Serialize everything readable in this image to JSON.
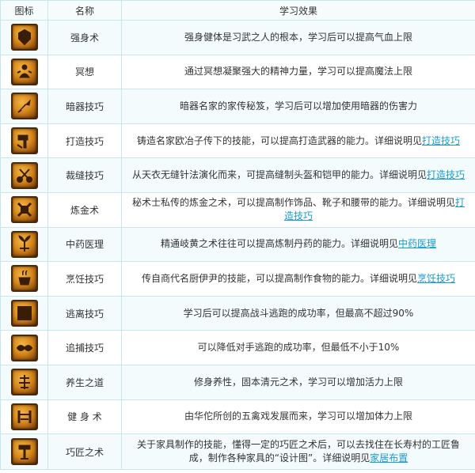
{
  "headers": {
    "icon": "图标",
    "name": "名称",
    "effect": "学习效果"
  },
  "rows": [
    {
      "icon": "strength-icon",
      "name": "强身术",
      "effect": "强身健体是习武之人的根本，学习后可以提高气血上限",
      "link": ""
    },
    {
      "icon": "meditation-icon",
      "name": "冥想",
      "effect": "通过冥想凝聚强大的精神力量，学习可以提高魔法上限",
      "link": ""
    },
    {
      "icon": "dart-icon",
      "name": "暗器技巧",
      "effect": "暗器名家的家传秘笈，学习后可以增加使用暗器的伤害力",
      "link": ""
    },
    {
      "icon": "hammer-icon",
      "name": "打造技巧",
      "effect": "铸造名家欧冶子传下的技能，可以提高打造武器的能力。详细说明见",
      "link": "打造技巧"
    },
    {
      "icon": "scissors-icon",
      "name": "裁缝技巧",
      "effect": "从天衣无缝针法演化而来，可提高缝制头盔和铠甲的能力。详细说明见",
      "link": "打造技巧"
    },
    {
      "icon": "alchemy-icon",
      "name": "炼金术",
      "effect": "秘术士私传的炼金之术，可以提高制作饰品、靴子和腰带的能力。详细说明见",
      "link": "打造技巧"
    },
    {
      "icon": "herb-icon",
      "name": "中药医理",
      "effect": "精通岐黄之术往往可以提高炼制丹药的能力。详细说明见",
      "link": "中药医理"
    },
    {
      "icon": "cooking-icon",
      "name": "烹饪技巧",
      "effect": "传自商代名厨伊尹的技能，可以提高制作食物的能力。详细说明见",
      "link": "烹饪技巧"
    },
    {
      "icon": "escape-icon",
      "name": "逃离技巧",
      "effect": "学习后可以提高战斗逃跑的成功率，但最高不超过90%",
      "link": ""
    },
    {
      "icon": "chase-icon",
      "name": "追捕技巧",
      "effect": "可以降低对手逃跑的成功率，但最低不小于10%",
      "link": ""
    },
    {
      "icon": "vitality-icon",
      "name": "养生之道",
      "effect": "修身养性，固本清元之术，学习可以增加活力上限",
      "link": ""
    },
    {
      "icon": "fitness-icon",
      "name": "健 身 术",
      "effect": "由华佗所创的五禽戏发展而来，学习可以增加体力上限",
      "link": ""
    },
    {
      "icon": "craftsman-icon",
      "name": "巧匠之术",
      "effect": "关于家具制作的技能，懂得一定的巧匠之术后，可以去找住在长寿村的工匠鲁成，制作各种家具的“设计图”。详细说明见",
      "link": "家居布置"
    }
  ]
}
